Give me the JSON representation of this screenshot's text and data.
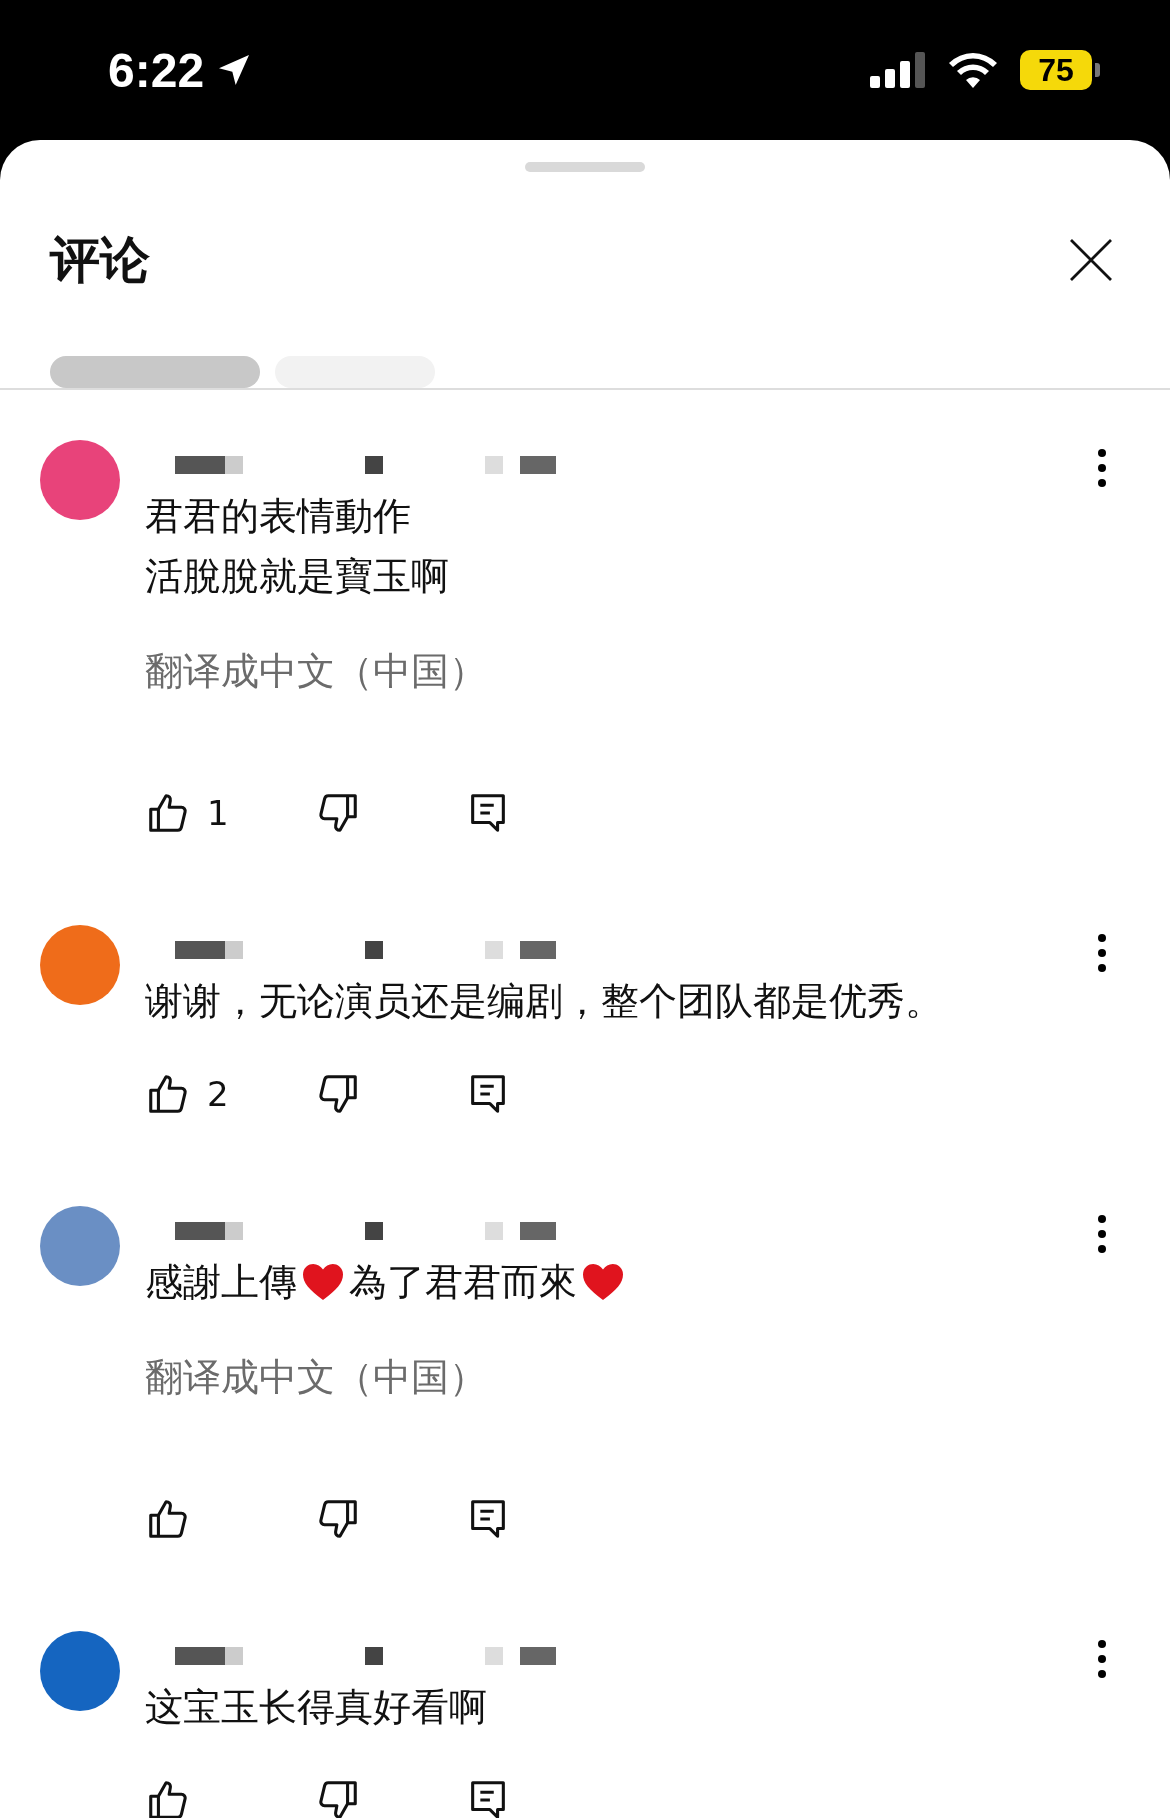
{
  "status_bar": {
    "time": "6:22",
    "battery": "75"
  },
  "sheet": {
    "title": "评论"
  },
  "comments": [
    {
      "color": "#e8437a",
      "lines": [
        [
          {
            "kind": "text",
            "text": "君君的表情動作"
          }
        ],
        [
          {
            "kind": "text",
            "text": "活脫脫就是寶玉啊"
          }
        ]
      ],
      "translate": "翻译成中文（中国）",
      "likes": "1"
    },
    {
      "color": "#ef6c1a",
      "lines": [
        [
          {
            "kind": "text",
            "text": "谢谢，无论演员还是编剧，整个团队都是优秀。"
          }
        ]
      ],
      "likes": "2"
    },
    {
      "color": "#6a8fc4",
      "lines": [
        [
          {
            "kind": "text",
            "text": "感謝上傳"
          },
          {
            "kind": "heart"
          },
          {
            "kind": "text",
            "text": "為了君君而來"
          },
          {
            "kind": "heart"
          }
        ]
      ],
      "translate": "翻译成中文（中国）"
    },
    {
      "color": "#1565c0",
      "lines": [
        [
          {
            "kind": "text",
            "text": "这宝玉长得真好看啊"
          }
        ]
      ]
    }
  ]
}
